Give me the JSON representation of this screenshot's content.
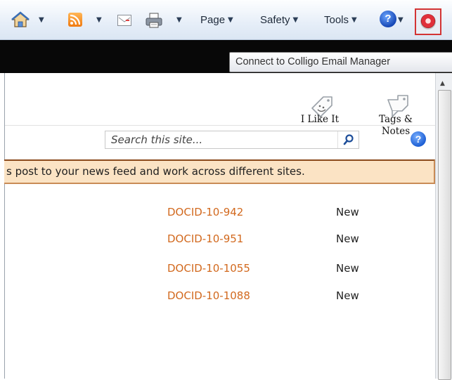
{
  "command_bar": {
    "home_icon": "home-icon",
    "feeds_icon": "rss-icon",
    "mail_icon": "mail-icon",
    "print_icon": "printer-icon",
    "menus": [
      {
        "label": "Page"
      },
      {
        "label": "Safety"
      },
      {
        "label": "Tools"
      }
    ],
    "help_glyph": "?",
    "colligo_icon": "colligo-icon"
  },
  "tooltip": {
    "text": "Connect to Colligo Email Manager"
  },
  "social": {
    "like_label": "I Like It",
    "tags_label_line1": "Tags &",
    "tags_label_line2": "Notes"
  },
  "search": {
    "placeholder": "Search this site...",
    "help_glyph": "?"
  },
  "banner": {
    "text": "s post to your news feed and work across different sites."
  },
  "documents": [
    {
      "id": "DOCID-10-942",
      "status": "New"
    },
    {
      "id": "DOCID-10-951",
      "status": "New"
    },
    {
      "id": "DOCID-10-1055",
      "status": "New"
    },
    {
      "id": "DOCID-10-1088",
      "status": "New"
    }
  ],
  "colors": {
    "doc_link": "#d2691e",
    "banner_bg": "#fbe3c4",
    "highlight_border": "#d33434"
  }
}
